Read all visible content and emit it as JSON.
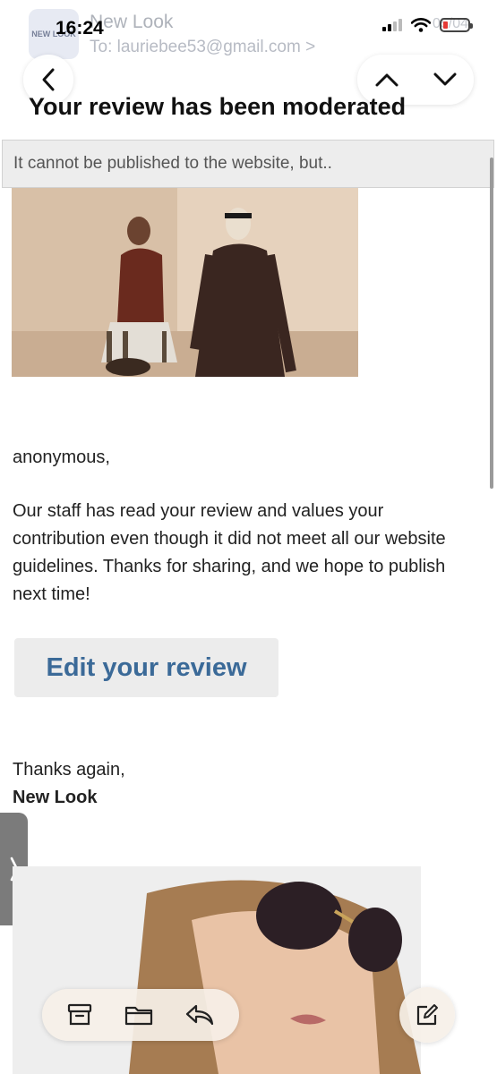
{
  "status_bar": {
    "time": "16:24"
  },
  "email": {
    "sender": "New Look",
    "to_line": "To: lauriebee53@gmail.com >",
    "date": "05/04",
    "subject": "Your review has been moderated",
    "preheader": "It cannot be published to the website, but..",
    "greeting": "anonymous,",
    "message": "Our staff has read your review and values your contribution even though it did not meet all our website guidelines. Thanks for sharing, and we hope to publish next time!",
    "edit_button": "Edit your review",
    "signoff": "Thanks again,",
    "brand": "New Look"
  },
  "sender_logo_text": "NEW LOOK",
  "icons": {
    "back": "chevron-left-icon",
    "prev": "chevron-up-icon",
    "next": "chevron-down-icon",
    "archive": "archive-icon",
    "folder": "folder-icon",
    "reply": "reply-icon",
    "compose": "compose-icon",
    "side_tab": "chevron-right-icon"
  },
  "colors": {
    "button_text": "#3b6a98",
    "battery_low": "#e53935"
  }
}
